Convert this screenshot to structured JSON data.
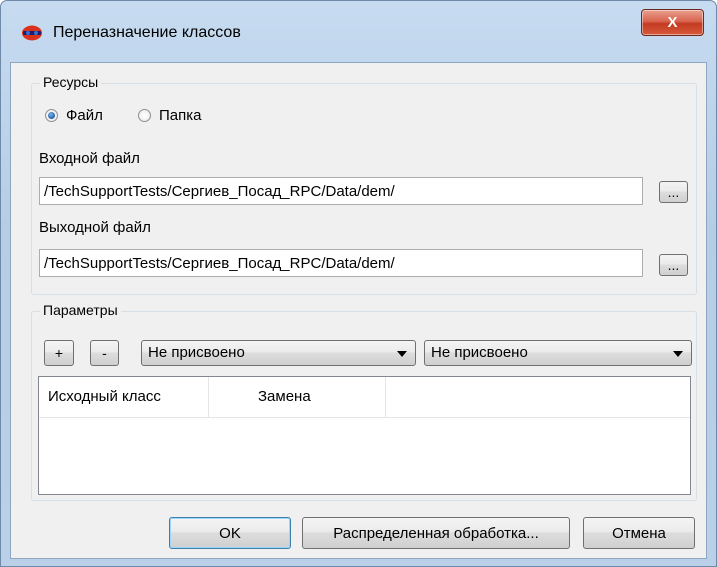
{
  "window": {
    "title": "Переназначение классов",
    "close_glyph": "X"
  },
  "resources": {
    "group_title": "Ресурсы",
    "radio_file_label": "Файл",
    "radio_folder_label": "Папка",
    "selected": "file",
    "input_label": "Входной файл",
    "input_value": "/TechSupportTests/Сергиев_Посад_RPC/Data/dem/",
    "output_label": "Выходной файл",
    "output_value": "/TechSupportTests/Сергиев_Посад_RPC/Data/dem/",
    "browse_label": "..."
  },
  "parameters": {
    "group_title": "Параметры",
    "add_label": "+",
    "remove_label": "-",
    "source_class_value": "Не присвоено",
    "target_class_value": "Не присвоено",
    "table_headers": [
      "Исходный класс",
      "Замена"
    ]
  },
  "buttons": {
    "ok": "OK",
    "distributed": "Распределенная обработка...",
    "cancel": "Отмена"
  },
  "icons": {
    "app": "app-logo-icon",
    "close": "close-icon",
    "dropdown": "chevron-down-icon"
  }
}
